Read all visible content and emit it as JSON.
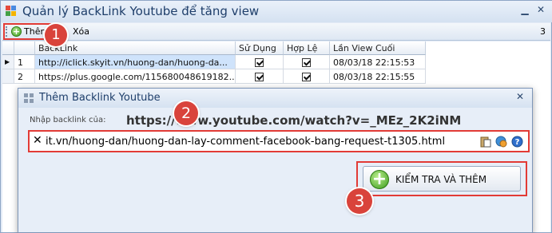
{
  "window": {
    "title": "Quản lý BackLink Youtube để tăng view",
    "close_glyph": "✕"
  },
  "toolbar": {
    "add_label": "Thêm",
    "delete_label": "Xóa",
    "count": "3"
  },
  "grid": {
    "columns": [
      "BackLink",
      "Sử Dụng",
      "Hợp Lệ",
      "Lần View Cuối"
    ],
    "rows": [
      {
        "num": "1",
        "backlink": "http://iclick.skyit.vn/huong-dan/huong-da...",
        "used": true,
        "valid": true,
        "last_view": "08/03/18 22:15:53"
      },
      {
        "num": "2",
        "backlink": "https://plus.google.com/115680048619182...",
        "used": true,
        "valid": true,
        "last_view": "08/03/18 22:15:55"
      }
    ],
    "current_row_indicator": "▶"
  },
  "dialog": {
    "title": "Thêm Backlink Youtube",
    "input_label": "Nhập backlink của:",
    "target_url": "https://www.youtube.com/watch?v=_MEz_2K2iNM",
    "input_value": "it.vn/huong-dan/huong-dan-lay-comment-facebook-bang-request-t1305.html",
    "clear_glyph": "✕",
    "button_label": "KIỂM TRA VÀ THÊM",
    "close_glyph": "✕"
  },
  "markers": [
    "1",
    "2",
    "3"
  ],
  "colors": {
    "marker": "#d9433b",
    "highlight": "#e23b36",
    "accent_green": "#3f9c22"
  }
}
